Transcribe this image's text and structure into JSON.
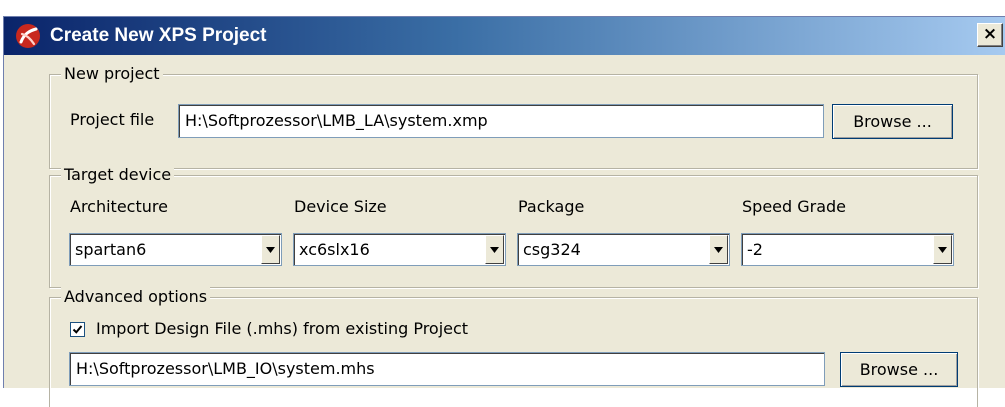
{
  "window": {
    "title": "Create New XPS Project",
    "close_label": "×"
  },
  "new_project": {
    "legend": "New project",
    "project_file_label": "Project file",
    "project_file_value": "H:\\Softprozessor\\LMB_LA\\system.xmp",
    "browse_label": "Browse ..."
  },
  "target_device": {
    "legend": "Target device",
    "fields": [
      {
        "label": "Architecture",
        "value": "spartan6"
      },
      {
        "label": "Device Size",
        "value": "xc6slx16"
      },
      {
        "label": "Package",
        "value": "csg324"
      },
      {
        "label": "Speed Grade",
        "value": "-2"
      }
    ]
  },
  "advanced_options": {
    "legend": "Advanced options",
    "import_checkbox_label": "Import Design File (.mhs) from existing Project",
    "import_checked": true,
    "mhs_file_value": "H:\\Softprozessor\\LMB_IO\\system.mhs",
    "browse_label": "Browse ..."
  },
  "icons": {
    "app": "xilinx-logo-icon",
    "close": "close-icon",
    "dropdown": "chevron-down-icon",
    "check": "check-icon"
  },
  "colors": {
    "titlebar_start": "#0a246a",
    "titlebar_end": "#a6caf0",
    "dialog_background": "#ece9d8",
    "title_text": "#ffffff"
  }
}
